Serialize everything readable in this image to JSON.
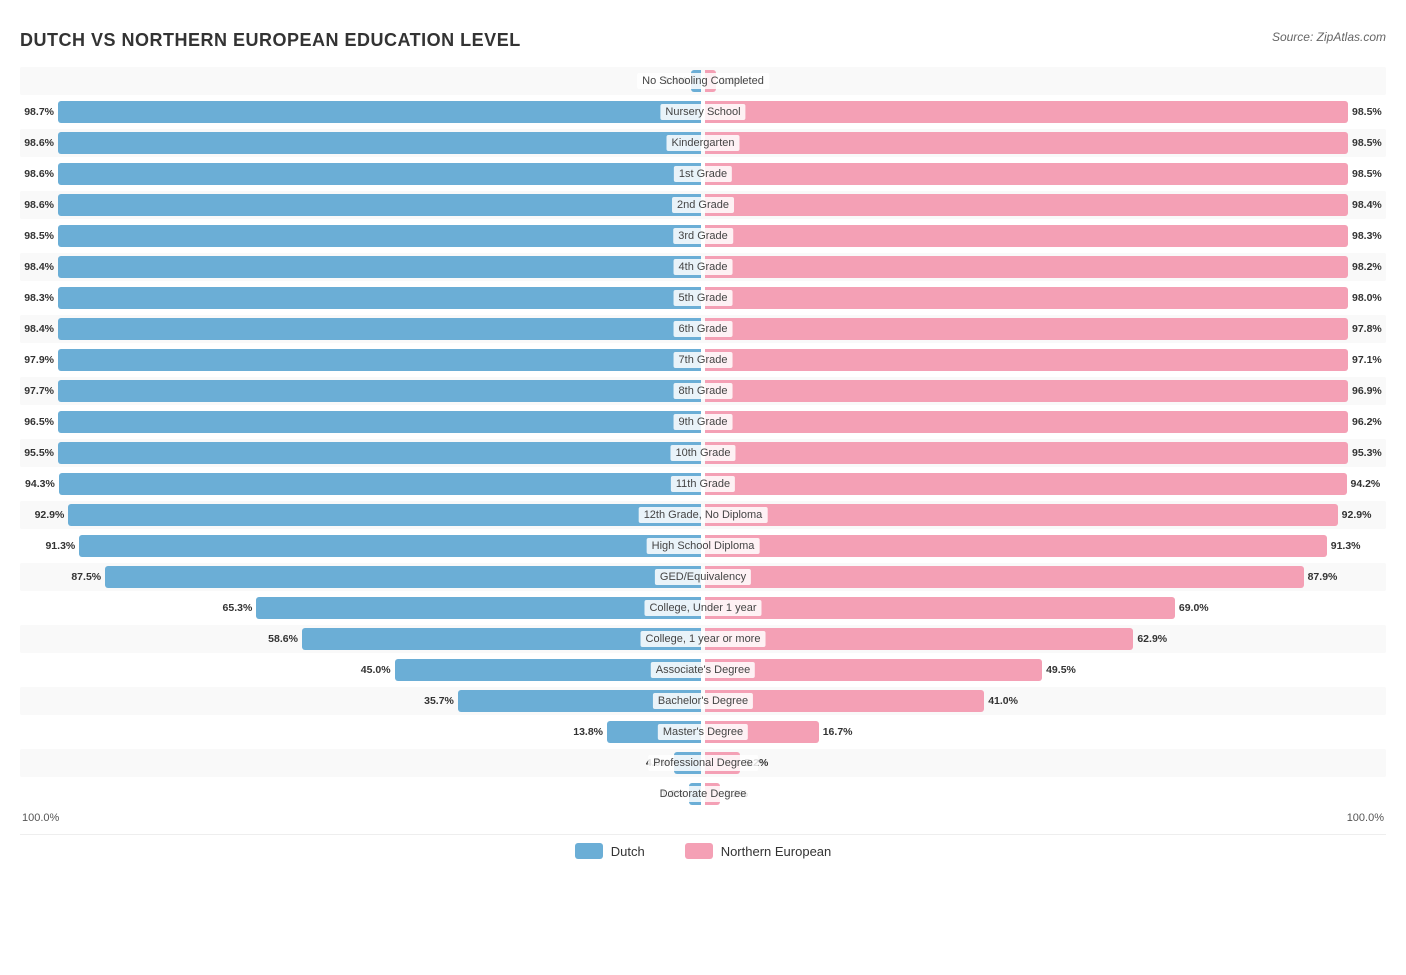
{
  "title": "DUTCH VS NORTHERN EUROPEAN EDUCATION LEVEL",
  "source": "Source: ZipAtlas.com",
  "legend": {
    "dutch_label": "Dutch",
    "dutch_color": "#6baed6",
    "ne_label": "Northern European",
    "ne_color": "#f4a0b5"
  },
  "axis": {
    "left": "100.0%",
    "right": "100.0%"
  },
  "rows": [
    {
      "label": "No Schooling Completed",
      "dutch": 1.4,
      "ne": 1.6,
      "dutch_str": "1.4%",
      "ne_str": "1.6%"
    },
    {
      "label": "Nursery School",
      "dutch": 98.7,
      "ne": 98.5,
      "dutch_str": "98.7%",
      "ne_str": "98.5%"
    },
    {
      "label": "Kindergarten",
      "dutch": 98.6,
      "ne": 98.5,
      "dutch_str": "98.6%",
      "ne_str": "98.5%"
    },
    {
      "label": "1st Grade",
      "dutch": 98.6,
      "ne": 98.5,
      "dutch_str": "98.6%",
      "ne_str": "98.5%"
    },
    {
      "label": "2nd Grade",
      "dutch": 98.6,
      "ne": 98.4,
      "dutch_str": "98.6%",
      "ne_str": "98.4%"
    },
    {
      "label": "3rd Grade",
      "dutch": 98.5,
      "ne": 98.3,
      "dutch_str": "98.5%",
      "ne_str": "98.3%"
    },
    {
      "label": "4th Grade",
      "dutch": 98.4,
      "ne": 98.2,
      "dutch_str": "98.4%",
      "ne_str": "98.2%"
    },
    {
      "label": "5th Grade",
      "dutch": 98.3,
      "ne": 98.0,
      "dutch_str": "98.3%",
      "ne_str": "98.0%"
    },
    {
      "label": "6th Grade",
      "dutch": 98.4,
      "ne": 97.8,
      "dutch_str": "98.4%",
      "ne_str": "97.8%"
    },
    {
      "label": "7th Grade",
      "dutch": 97.9,
      "ne": 97.1,
      "dutch_str": "97.9%",
      "ne_str": "97.1%"
    },
    {
      "label": "8th Grade",
      "dutch": 97.7,
      "ne": 96.9,
      "dutch_str": "97.7%",
      "ne_str": "96.9%"
    },
    {
      "label": "9th Grade",
      "dutch": 96.5,
      "ne": 96.2,
      "dutch_str": "96.5%",
      "ne_str": "96.2%"
    },
    {
      "label": "10th Grade",
      "dutch": 95.5,
      "ne": 95.3,
      "dutch_str": "95.5%",
      "ne_str": "95.3%"
    },
    {
      "label": "11th Grade",
      "dutch": 94.3,
      "ne": 94.2,
      "dutch_str": "94.3%",
      "ne_str": "94.2%"
    },
    {
      "label": "12th Grade, No Diploma",
      "dutch": 92.9,
      "ne": 92.9,
      "dutch_str": "92.9%",
      "ne_str": "92.9%"
    },
    {
      "label": "High School Diploma",
      "dutch": 91.3,
      "ne": 91.3,
      "dutch_str": "91.3%",
      "ne_str": "91.3%"
    },
    {
      "label": "GED/Equivalency",
      "dutch": 87.5,
      "ne": 87.9,
      "dutch_str": "87.5%",
      "ne_str": "87.9%"
    },
    {
      "label": "College, Under 1 year",
      "dutch": 65.3,
      "ne": 69.0,
      "dutch_str": "65.3%",
      "ne_str": "69.0%"
    },
    {
      "label": "College, 1 year or more",
      "dutch": 58.6,
      "ne": 62.9,
      "dutch_str": "58.6%",
      "ne_str": "62.9%"
    },
    {
      "label": "Associate's Degree",
      "dutch": 45.0,
      "ne": 49.5,
      "dutch_str": "45.0%",
      "ne_str": "49.5%"
    },
    {
      "label": "Bachelor's Degree",
      "dutch": 35.7,
      "ne": 41.0,
      "dutch_str": "35.7%",
      "ne_str": "41.0%"
    },
    {
      "label": "Master's Degree",
      "dutch": 13.8,
      "ne": 16.7,
      "dutch_str": "13.8%",
      "ne_str": "16.7%"
    },
    {
      "label": "Professional Degree",
      "dutch": 4.0,
      "ne": 5.2,
      "dutch_str": "4.0%",
      "ne_str": "5.2%"
    },
    {
      "label": "Doctorate Degree",
      "dutch": 1.8,
      "ne": 2.2,
      "dutch_str": "1.8%",
      "ne_str": "2.2%"
    }
  ]
}
